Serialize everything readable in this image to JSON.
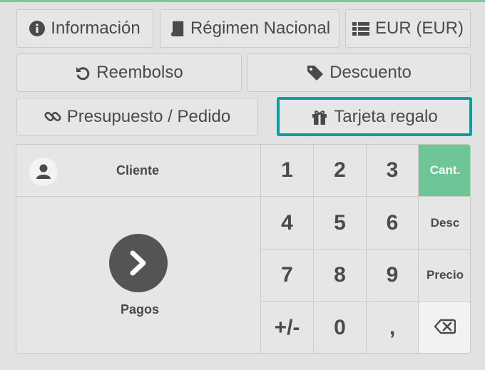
{
  "toolbar": {
    "info": {
      "label": "Información",
      "icon": "info-circle-icon"
    },
    "regimen": {
      "label": "Régimen Nacional",
      "icon": "book-icon"
    },
    "currency": {
      "label": "EUR (EUR)",
      "icon": "list-icon"
    },
    "reembolso": {
      "label": "Reembolso",
      "icon": "undo-icon"
    },
    "descuento": {
      "label": "Descuento",
      "icon": "tag-icon"
    },
    "presupuesto": {
      "label": "Presupuesto / Pedido",
      "icon": "link-icon"
    },
    "tarjeta": {
      "label": "Tarjeta regalo",
      "icon": "gift-icon"
    }
  },
  "customer": {
    "label": "Cliente",
    "icon": "user-icon"
  },
  "payment": {
    "label": "Pagos",
    "icon": "chevron-right-icon"
  },
  "numpad": {
    "k1": "1",
    "k2": "2",
    "k3": "3",
    "mode_qty": "Cant.",
    "k4": "4",
    "k5": "5",
    "k6": "6",
    "mode_disc": "Desc",
    "k7": "7",
    "k8": "8",
    "k9": "9",
    "mode_price": "Precio",
    "sign": "+/-",
    "k0": "0",
    "decimal": ",",
    "backspace_icon": "backspace-icon",
    "active_mode": "Cant."
  },
  "colors": {
    "accent": "#6ec596",
    "highlight": "#0e9d9d",
    "pay_button": "#545454"
  }
}
